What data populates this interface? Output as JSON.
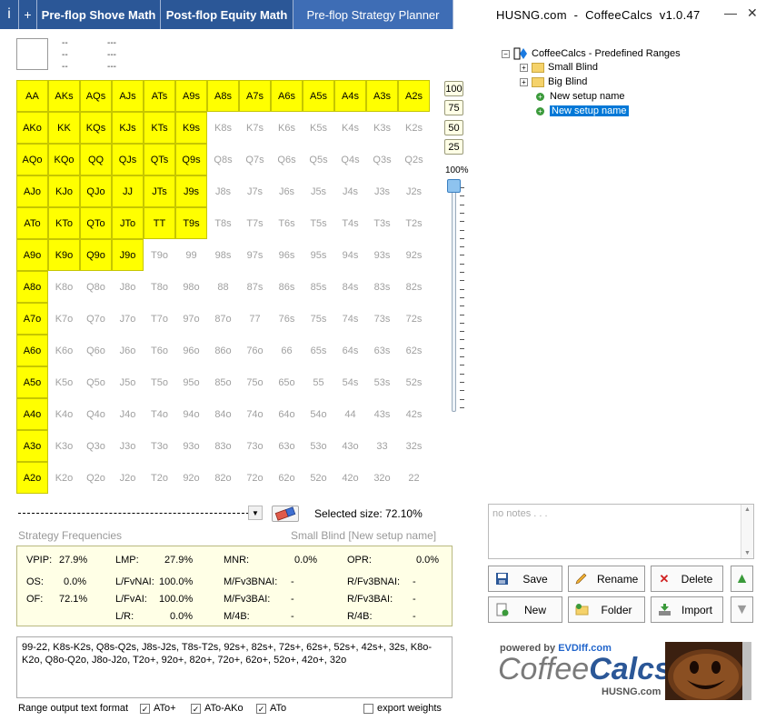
{
  "tabs": {
    "info": "i",
    "add": "+",
    "shove": "Pre-flop Shove Math",
    "postflop": "Post-flop Equity Math",
    "planner": "Pre-flop Strategy Planner"
  },
  "window": {
    "title": "HUSNG.com  -  CoffeeCalcs  v1.0.47",
    "minimize": "—",
    "close": "✕"
  },
  "preview": {
    "dashes": [
      "--",
      "---",
      "--",
      "---",
      "--",
      "---"
    ]
  },
  "grid": {
    "ranks": [
      "A",
      "K",
      "Q",
      "J",
      "T",
      "9",
      "8",
      "7",
      "6",
      "5",
      "4",
      "3",
      "2"
    ],
    "cells": [
      [
        "AA",
        "AKs",
        "AQs",
        "AJs",
        "ATs",
        "A9s",
        "A8s",
        "A7s",
        "A6s",
        "A5s",
        "A4s",
        "A3s",
        "A2s"
      ],
      [
        "AKo",
        "KK",
        "KQs",
        "KJs",
        "KTs",
        "K9s",
        "K8s",
        "K7s",
        "K6s",
        "K5s",
        "K4s",
        "K3s",
        "K2s"
      ],
      [
        "AQo",
        "KQo",
        "QQ",
        "QJs",
        "QTs",
        "Q9s",
        "Q8s",
        "Q7s",
        "Q6s",
        "Q5s",
        "Q4s",
        "Q3s",
        "Q2s"
      ],
      [
        "AJo",
        "KJo",
        "QJo",
        "JJ",
        "JTs",
        "J9s",
        "J8s",
        "J7s",
        "J6s",
        "J5s",
        "J4s",
        "J3s",
        "J2s"
      ],
      [
        "ATo",
        "KTo",
        "QTo",
        "JTo",
        "TT",
        "T9s",
        "T8s",
        "T7s",
        "T6s",
        "T5s",
        "T4s",
        "T3s",
        "T2s"
      ],
      [
        "A9o",
        "K9o",
        "Q9o",
        "J9o",
        "T9o",
        "99",
        "98s",
        "97s",
        "96s",
        "95s",
        "94s",
        "93s",
        "92s"
      ],
      [
        "A8o",
        "K8o",
        "Q8o",
        "J8o",
        "T8o",
        "98o",
        "88",
        "87s",
        "86s",
        "85s",
        "84s",
        "83s",
        "82s"
      ],
      [
        "A7o",
        "K7o",
        "Q7o",
        "J7o",
        "T7o",
        "97o",
        "87o",
        "77",
        "76s",
        "75s",
        "74s",
        "73s",
        "72s"
      ],
      [
        "A6o",
        "K6o",
        "Q6o",
        "J6o",
        "T6o",
        "96o",
        "86o",
        "76o",
        "66",
        "65s",
        "64s",
        "63s",
        "62s"
      ],
      [
        "A5o",
        "K5o",
        "Q5o",
        "J5o",
        "T5o",
        "95o",
        "85o",
        "75o",
        "65o",
        "55",
        "54s",
        "53s",
        "52s"
      ],
      [
        "A4o",
        "K4o",
        "Q4o",
        "J4o",
        "T4o",
        "94o",
        "84o",
        "74o",
        "64o",
        "54o",
        "44",
        "43s",
        "42s"
      ],
      [
        "A3o",
        "K3o",
        "Q3o",
        "J3o",
        "T3o",
        "93o",
        "83o",
        "73o",
        "63o",
        "53o",
        "43o",
        "33",
        "32s"
      ],
      [
        "A2o",
        "K2o",
        "Q2o",
        "J2o",
        "T2o",
        "92o",
        "82o",
        "72o",
        "62o",
        "52o",
        "42o",
        "32o",
        "22"
      ]
    ],
    "selected": [
      [
        true,
        true,
        true,
        true,
        true,
        true,
        true,
        true,
        true,
        true,
        true,
        true,
        true
      ],
      [
        true,
        true,
        true,
        true,
        true,
        true,
        false,
        false,
        false,
        false,
        false,
        false,
        false
      ],
      [
        true,
        true,
        true,
        true,
        true,
        true,
        false,
        false,
        false,
        false,
        false,
        false,
        false
      ],
      [
        true,
        true,
        true,
        true,
        true,
        true,
        false,
        false,
        false,
        false,
        false,
        false,
        false
      ],
      [
        true,
        true,
        true,
        true,
        true,
        true,
        false,
        false,
        false,
        false,
        false,
        false,
        false
      ],
      [
        true,
        true,
        true,
        true,
        false,
        false,
        false,
        false,
        false,
        false,
        false,
        false,
        false
      ],
      [
        true,
        false,
        false,
        false,
        false,
        false,
        false,
        false,
        false,
        false,
        false,
        false,
        false
      ],
      [
        true,
        false,
        false,
        false,
        false,
        false,
        false,
        false,
        false,
        false,
        false,
        false,
        false
      ],
      [
        true,
        false,
        false,
        false,
        false,
        false,
        false,
        false,
        false,
        false,
        false,
        false,
        false
      ],
      [
        true,
        false,
        false,
        false,
        false,
        false,
        false,
        false,
        false,
        false,
        false,
        false,
        false
      ],
      [
        true,
        false,
        false,
        false,
        false,
        false,
        false,
        false,
        false,
        false,
        false,
        false,
        false
      ],
      [
        true,
        false,
        false,
        false,
        false,
        false,
        false,
        false,
        false,
        false,
        false,
        false,
        false
      ],
      [
        true,
        false,
        false,
        false,
        false,
        false,
        false,
        false,
        false,
        false,
        false,
        false,
        false
      ]
    ],
    "selected_color": "#ffff00"
  },
  "percent_buttons": [
    "100",
    "75",
    "50",
    "25"
  ],
  "slider": {
    "label": "100%",
    "level_percent": 100
  },
  "selection": {
    "selected_size_text": "Selected size: 72.10%"
  },
  "strategy": {
    "label": "Strategy Frequencies",
    "context": "Small Blind [New setup name]",
    "stats": {
      "vpip_label": "VPIP:",
      "vpip": "27.9%",
      "os_label": "OS:",
      "os": "0.0%",
      "of_label": "OF:",
      "of": "72.1%",
      "lmp_label": "LMP:",
      "lmp": "27.9%",
      "lfvnai_label": "L/FvNAI:",
      "lfvnai": "100.0%",
      "lfvai_label": "L/FvAI:",
      "lfvai": "100.0%",
      "lr_label": "L/R:",
      "lr": "0.0%",
      "mnr_label": "MNR:",
      "mnr": "0.0%",
      "mfv3bnai_label": "M/Fv3BNAI:",
      "mfv3bnai": "-",
      "mfv3bai_label": "M/Fv3BAI:",
      "mfv3bai": "-",
      "m4b_label": "M/4B:",
      "m4b": "-",
      "opr_label": "OPR:",
      "opr": "0.0%",
      "rfv3bnai_label": "R/Fv3BNAI:",
      "rfv3bnai": "-",
      "rfv3bai_label": "R/Fv3BAI:",
      "rfv3bai": "-",
      "r4b_label": "R/4B:",
      "r4b": "-"
    }
  },
  "range_text": "99-22, K8s-K2s, Q8s-Q2s, J8s-J2s, T8s-T2s, 92s+, 82s+, 72s+, 62s+, 52s+, 42s+, 32s, K8o-K2o, Q8o-Q2o, J8o-J2o, T2o+, 92o+, 82o+, 72o+, 62o+, 52o+, 42o+, 32o",
  "format": {
    "label": "Range output text format",
    "ato_plus": "ATo+",
    "ato_ako": "ATo-AKo",
    "ato": "ATo",
    "export": "export weights",
    "check": "✓"
  },
  "tree": {
    "root": "CoffeeCalcs - Predefined Ranges",
    "small_blind": "Small Blind",
    "big_blind": "Big Blind",
    "setup1": "New setup name",
    "setup2": "New setup name"
  },
  "notes": {
    "placeholder": "no notes . . ."
  },
  "actions": {
    "save": "Save",
    "rename": "Rename",
    "delete": "Delete",
    "new": "New",
    "folder": "Folder",
    "import": "Import"
  },
  "logo": {
    "powered_prefix": "powered by ",
    "powered_brand": "EVDIff.com",
    "coffee": "Coffee",
    "calcs": "Calcs",
    "husng": "HUSNG.com"
  },
  "colors": {
    "tab_bg": "#2b5797",
    "tab_active_bg": "#3e6db5",
    "stat_bg": "#ffffe6",
    "tree_highlight": "#0078d7"
  }
}
